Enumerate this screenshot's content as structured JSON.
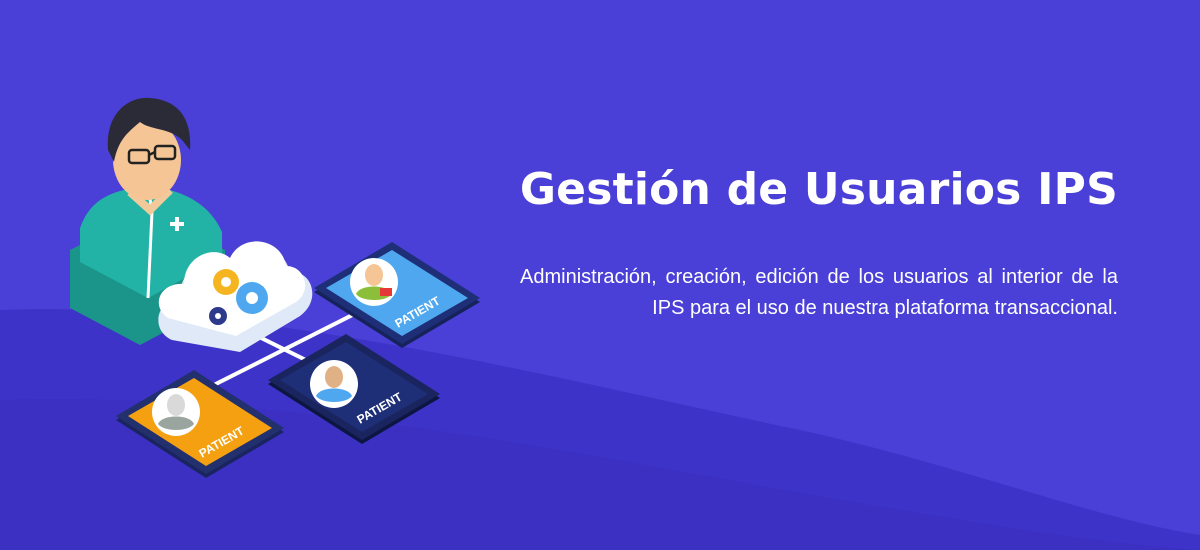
{
  "banner": {
    "title": "Gestión de Usuarios IPS",
    "description": "Administración, creación, edición de los usuarios al interior de la IPS para el uso de nuestra plataforma transaccional.",
    "colors": {
      "background": "#4a3fd6",
      "background_shade": "#3d31c2",
      "text": "#ffffff",
      "doctor_scrubs": "#22b3a6",
      "tablet_orange": "#f5a011",
      "tablet_blue": "#4ea7ef",
      "tablet_navy": "#1e2f78"
    },
    "illustration": {
      "tablet_labels": [
        "PATIENT",
        "PATIENT",
        "PATIENT"
      ]
    }
  }
}
